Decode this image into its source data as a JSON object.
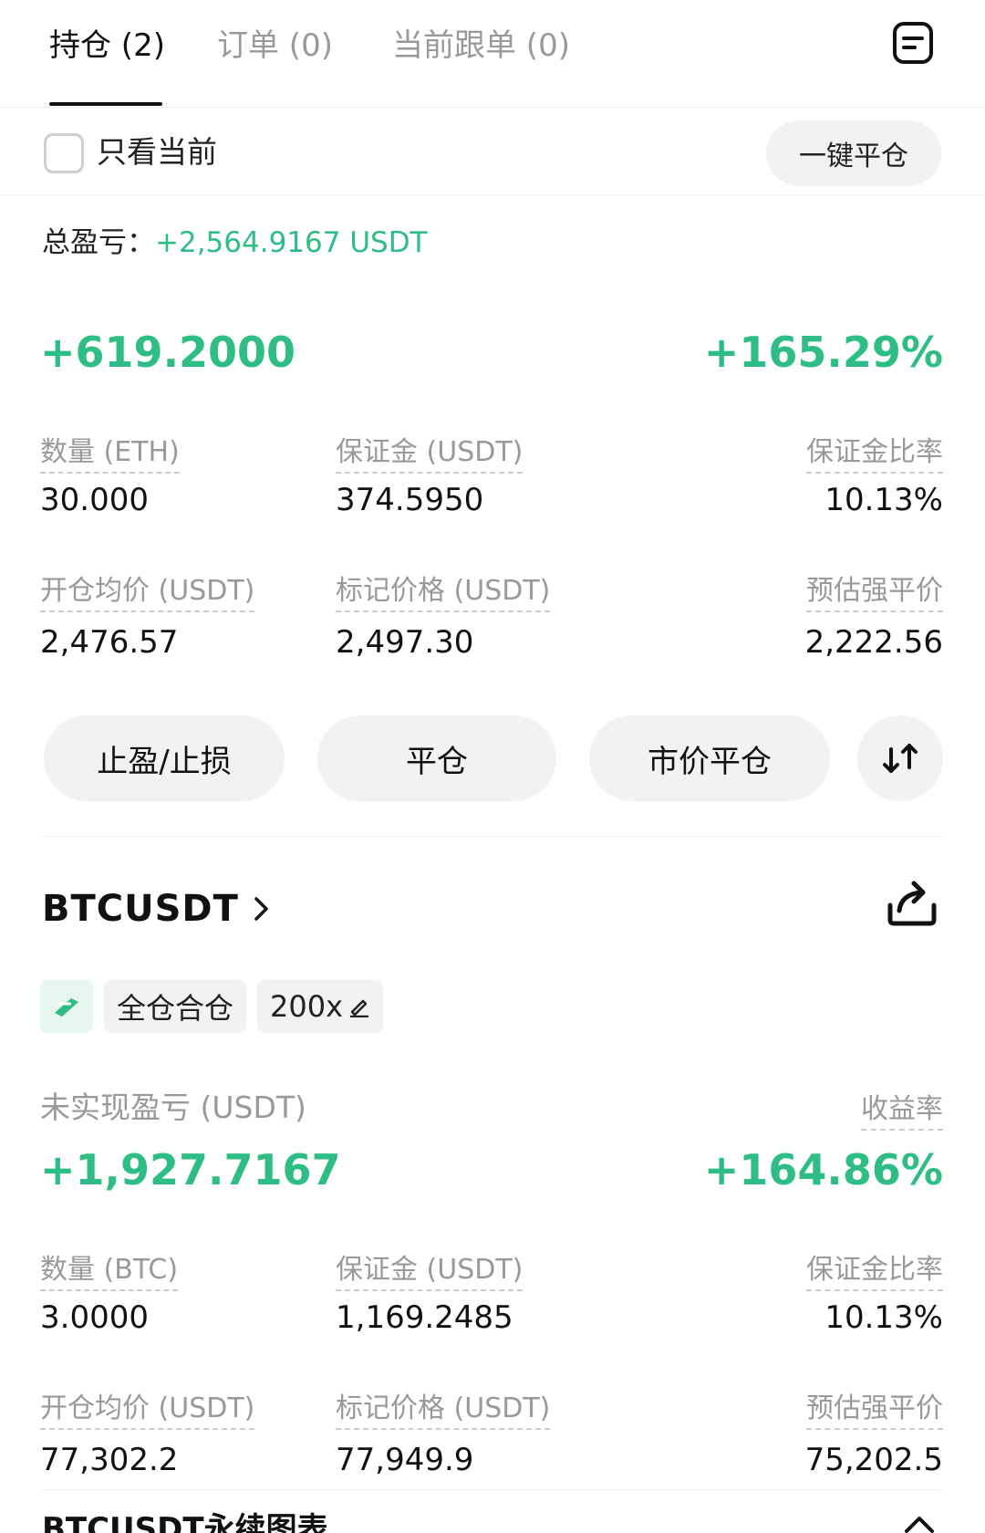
{
  "tabs": [
    {
      "label": "持仓 (2)",
      "active": true
    },
    {
      "label": "订单 (0)",
      "active": false
    },
    {
      "label": "当前跟单 (0)",
      "active": false
    }
  ],
  "filter": {
    "only_current_label": "只看当前",
    "only_current_checked": false,
    "close_all_label": "一键平仓"
  },
  "summary": {
    "total_pnl_label": "总盈亏：",
    "total_pnl_value": "+2,564.9167 USDT"
  },
  "positions": [
    {
      "unrealized_pnl": "+619.2000",
      "roi": "+165.29%",
      "cells": [
        {
          "label": "数量 (ETH)",
          "value": "30.000"
        },
        {
          "label": "保证金 (USDT)",
          "value": "374.5950"
        },
        {
          "label": "保证金比率",
          "value": "10.13%"
        },
        {
          "label": "开仓均价 (USDT)",
          "value": "2,476.57"
        },
        {
          "label": "标记价格 (USDT)",
          "value": "2,497.30"
        },
        {
          "label": "预估强平价",
          "value": "2,222.56"
        }
      ],
      "actions": [
        {
          "label": "止盈/止损"
        },
        {
          "label": "平仓"
        },
        {
          "label": "市价平仓"
        }
      ]
    },
    {
      "symbol": "BTCUSDT",
      "tags": [
        "全仓合仓",
        "200x"
      ],
      "unrealized_pnl_label": "未实现盈亏 (USDT)",
      "roi_label": "收益率",
      "unrealized_pnl": "+1,927.7167",
      "roi": "+164.86%",
      "cells": [
        {
          "label": "数量 (BTC)",
          "value": "3.0000"
        },
        {
          "label": "保证金 (USDT)",
          "value": "1,169.2485"
        },
        {
          "label": "保证金比率",
          "value": "10.13%"
        },
        {
          "label": "开仓均价 (USDT)",
          "value": "77,302.2"
        },
        {
          "label": "标记价格 (USDT)",
          "value": "77,949.9"
        },
        {
          "label": "预估强平价",
          "value": "75,202.5"
        }
      ]
    }
  ],
  "footer": {
    "title": "BTCUSDT永续图表"
  },
  "icons": {
    "doc": "document-icon",
    "share": "share-icon",
    "reverse": "swap-icon",
    "tag": "coupon-icon",
    "edit": "pencil-icon",
    "chevron": "chevron-right-icon"
  },
  "colors": {
    "profit_green": "#2ebd85",
    "muted_gray": "#999999"
  }
}
